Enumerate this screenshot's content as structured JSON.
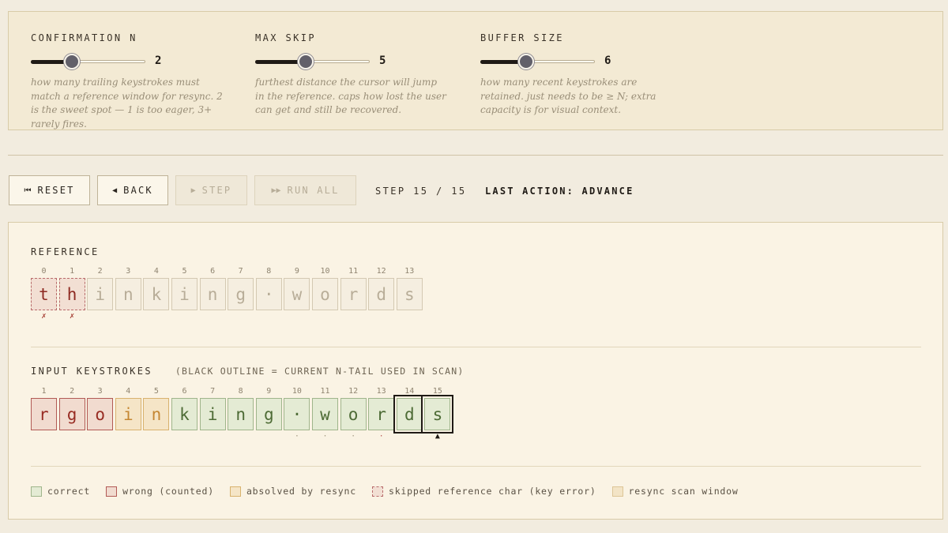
{
  "settings": [
    {
      "label": "CONFIRMATION N",
      "value": "2",
      "fraction": 0.36,
      "desc": "how many trailing keystrokes must match a reference window for resync. 2 is the sweet spot — 1 is too eager, 3+ rarely fires."
    },
    {
      "label": "MAX SKIP",
      "value": "5",
      "fraction": 0.44,
      "desc": "furthest distance the cursor will jump in the reference. caps how lost the user can get and still be recovered."
    },
    {
      "label": "BUFFER SIZE",
      "value": "6",
      "fraction": 0.4,
      "desc": "how many recent keystrokes are retained. just needs to be ≥ N; extra capacity is for visual context."
    }
  ],
  "toolbar": {
    "reset": {
      "icon": "⏮",
      "label": "RESET"
    },
    "back": {
      "icon": "◀",
      "label": "BACK"
    },
    "step": {
      "icon": "▶",
      "label": "STEP"
    },
    "run_all": {
      "icon": "▶▶",
      "label": "RUN ALL"
    },
    "step_info": "STEP 15 / 15",
    "last_action": "LAST ACTION: ADVANCE"
  },
  "reference": {
    "label": "REFERENCE",
    "cells": [
      {
        "idx": "0",
        "char": "t",
        "state": "skipped",
        "mark": "✗"
      },
      {
        "idx": "1",
        "char": "h",
        "state": "skipped",
        "mark": "✗"
      },
      {
        "idx": "2",
        "char": "i",
        "state": "pending",
        "mark": ""
      },
      {
        "idx": "3",
        "char": "n",
        "state": "pending",
        "mark": ""
      },
      {
        "idx": "4",
        "char": "k",
        "state": "pending",
        "mark": ""
      },
      {
        "idx": "5",
        "char": "i",
        "state": "pending",
        "mark": ""
      },
      {
        "idx": "6",
        "char": "n",
        "state": "pending",
        "mark": ""
      },
      {
        "idx": "7",
        "char": "g",
        "state": "pending",
        "mark": ""
      },
      {
        "idx": "8",
        "char": "·",
        "state": "pending",
        "mark": ""
      },
      {
        "idx": "9",
        "char": "w",
        "state": "pending",
        "mark": ""
      },
      {
        "idx": "10",
        "char": "o",
        "state": "pending",
        "mark": ""
      },
      {
        "idx": "11",
        "char": "r",
        "state": "pending",
        "mark": ""
      },
      {
        "idx": "12",
        "char": "d",
        "state": "pending",
        "mark": ""
      },
      {
        "idx": "13",
        "char": "s",
        "state": "pending",
        "mark": ""
      }
    ]
  },
  "input": {
    "label": "INPUT KEYSTROKES",
    "note": "(BLACK OUTLINE = CURRENT N-TAIL USED IN SCAN)",
    "cells": [
      {
        "idx": "1",
        "char": "r",
        "state": "wrong",
        "tail": false,
        "mark": ""
      },
      {
        "idx": "2",
        "char": "g",
        "state": "wrong",
        "tail": false,
        "mark": ""
      },
      {
        "idx": "3",
        "char": "o",
        "state": "wrong",
        "tail": false,
        "mark": ""
      },
      {
        "idx": "4",
        "char": "i",
        "state": "absolved",
        "tail": false,
        "mark": ""
      },
      {
        "idx": "5",
        "char": "n",
        "state": "absolved",
        "tail": false,
        "mark": ""
      },
      {
        "idx": "6",
        "char": "k",
        "state": "correct",
        "tail": false,
        "mark": ""
      },
      {
        "idx": "7",
        "char": "i",
        "state": "correct",
        "tail": false,
        "mark": ""
      },
      {
        "idx": "8",
        "char": "n",
        "state": "correct",
        "tail": false,
        "mark": ""
      },
      {
        "idx": "9",
        "char": "g",
        "state": "correct",
        "tail": false,
        "mark": ""
      },
      {
        "idx": "10",
        "char": "·",
        "state": "correct",
        "tail": false,
        "mark": "·"
      },
      {
        "idx": "11",
        "char": "w",
        "state": "correct",
        "tail": false,
        "mark": "·"
      },
      {
        "idx": "12",
        "char": "o",
        "state": "correct",
        "tail": false,
        "mark": "·"
      },
      {
        "idx": "13",
        "char": "r",
        "state": "correct",
        "tail": false,
        "mark": "·"
      },
      {
        "idx": "14",
        "char": "d",
        "state": "correct",
        "tail": true,
        "mark": ""
      },
      {
        "idx": "15",
        "char": "s",
        "state": "correct",
        "tail": true,
        "mark": "▲"
      }
    ]
  },
  "legend": [
    {
      "key": "correct",
      "label": "correct"
    },
    {
      "key": "wrong",
      "label": "wrong (counted)"
    },
    {
      "key": "absolved",
      "label": "absolved by resync"
    },
    {
      "key": "skipped",
      "label": "skipped reference char (key error)"
    },
    {
      "key": "window",
      "label": "resync scan window"
    }
  ],
  "colors": {
    "correct": "#e4ebd4",
    "wrong": "#f1dbcf",
    "absolved": "#f5e5c7",
    "skipped": "#f2dfd3",
    "window": "#f3e4c6"
  }
}
